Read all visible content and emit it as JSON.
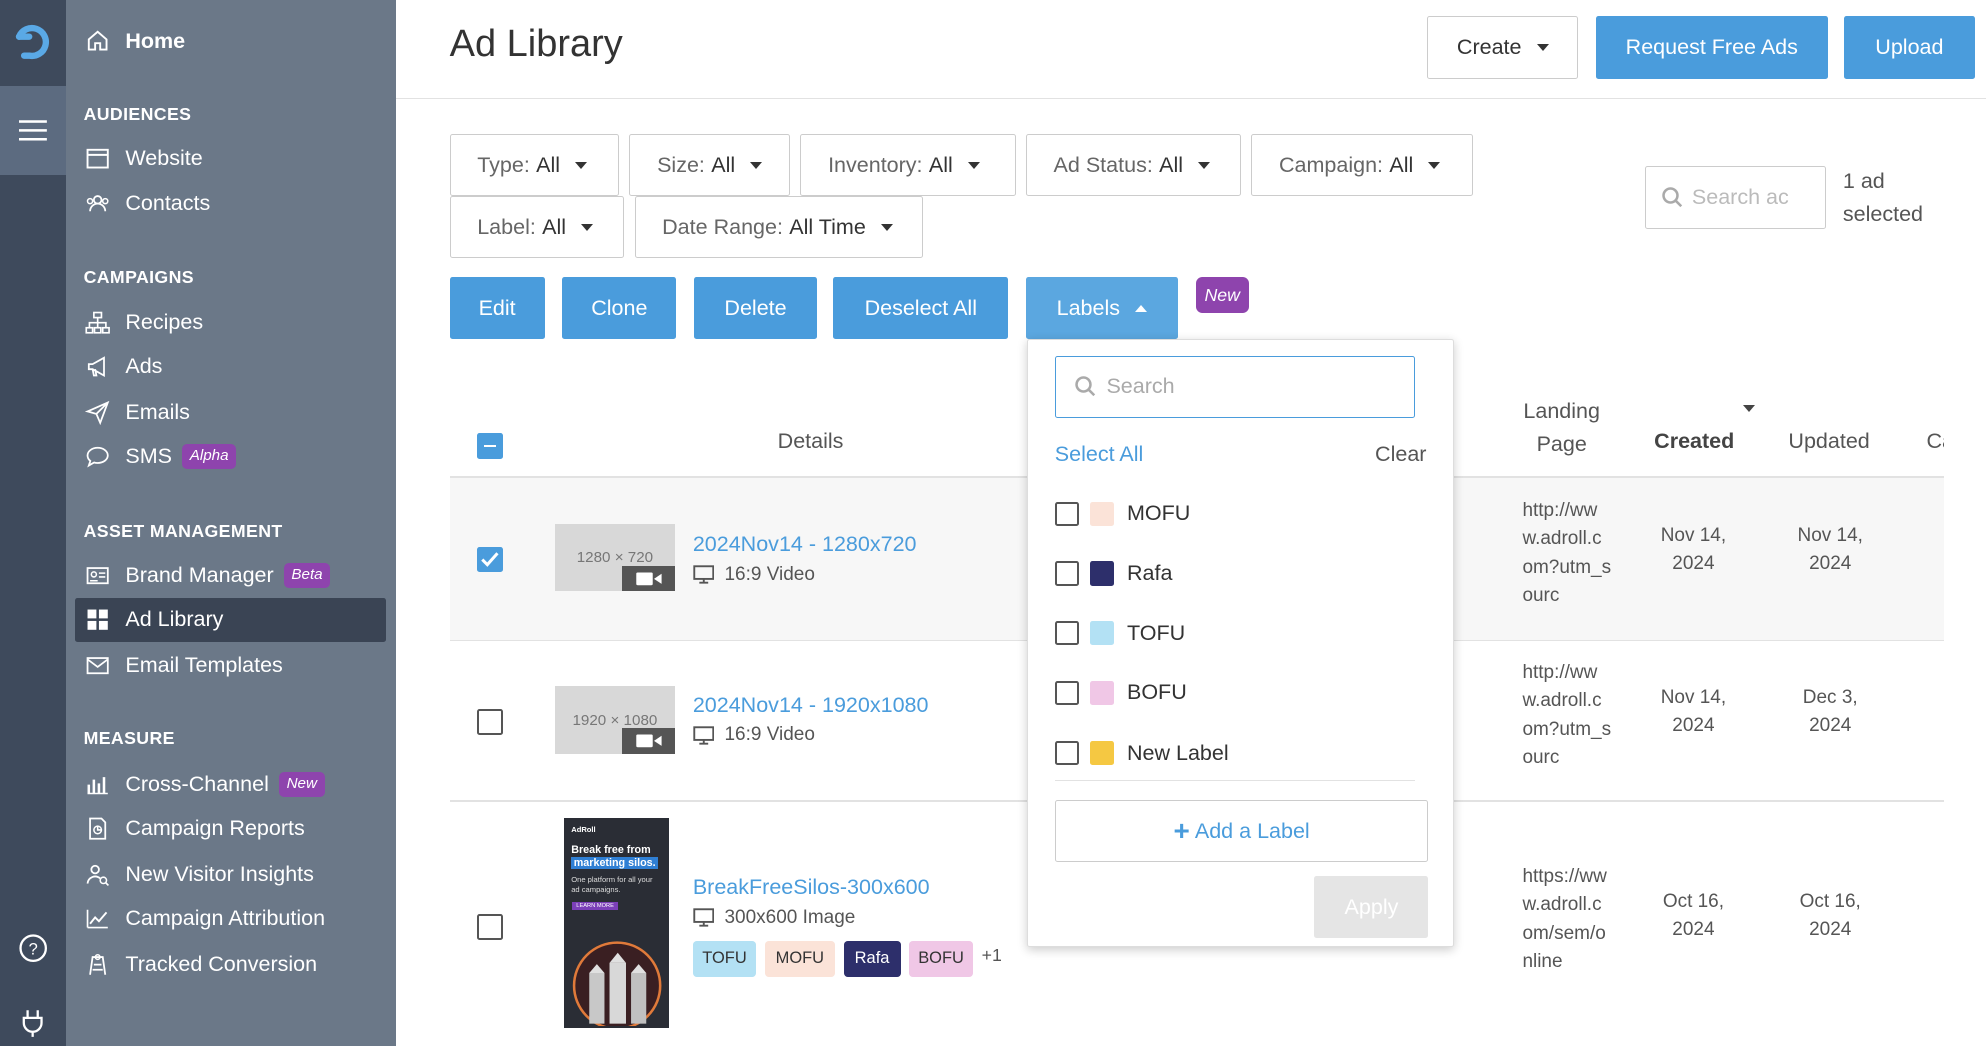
{
  "sidebar": {
    "home": "Home",
    "sections": {
      "audiences": "AUDIENCES",
      "campaigns": "CAMPAIGNS",
      "asset_management": "ASSET MANAGEMENT",
      "measure": "MEASURE"
    },
    "items": {
      "website": "Website",
      "contacts": "Contacts",
      "recipes": "Recipes",
      "ads": "Ads",
      "emails": "Emails",
      "sms": "SMS",
      "sms_badge": "Alpha",
      "brand_manager": "Brand Manager",
      "brand_manager_badge": "Beta",
      "ad_library": "Ad Library",
      "email_templates": "Email Templates",
      "cross_channel": "Cross-Channel",
      "cross_channel_badge": "New",
      "campaign_reports": "Campaign Reports",
      "new_visitor_insights": "New Visitor Insights",
      "campaign_attribution": "Campaign Attribution",
      "tracked_conversion": "Tracked Conversion"
    }
  },
  "header": {
    "title": "Ad Library",
    "create": "Create",
    "request_free_ads": "Request Free Ads",
    "upload": "Upload"
  },
  "filters": {
    "type": {
      "label": "Type:",
      "value": "All"
    },
    "size": {
      "label": "Size:",
      "value": "All"
    },
    "inventory": {
      "label": "Inventory:",
      "value": "All"
    },
    "ad_status": {
      "label": "Ad Status:",
      "value": "All"
    },
    "campaign": {
      "label": "Campaign:",
      "value": "All"
    },
    "label": {
      "label": "Label:",
      "value": "All"
    },
    "date_range": {
      "label": "Date Range:",
      "value": "All Time"
    }
  },
  "search": {
    "placeholder": "Search ac"
  },
  "selection": {
    "count_text": "1 ad selected"
  },
  "actions": {
    "edit": "Edit",
    "clone": "Clone",
    "delete": "Delete",
    "deselect_all": "Deselect All",
    "labels": "Labels",
    "new_badge": "New"
  },
  "table": {
    "headers": {
      "details": "Details",
      "landing_line1": "Landing",
      "landing_line2": "Page",
      "created": "Created",
      "updated": "Updated",
      "more": "Ca"
    },
    "rows": [
      {
        "thumb": "1280 × 720",
        "name": "2024Nov14 - 1280x720",
        "type": "16:9 Video",
        "landing": "http://www.adroll.com?utm_sourc",
        "created": "Nov 14, 2024",
        "updated": "Nov 14, 2024",
        "checked": true
      },
      {
        "thumb": "1920 × 1080",
        "name": "2024Nov14 - 1920x1080",
        "type": "16:9 Video",
        "landing": "http://www.adroll.com?utm_sourc",
        "created": "Nov 14, 2024",
        "updated": "Dec 3, 2024",
        "checked": false
      },
      {
        "name": "BreakFreeSilos-300x600",
        "type": "300x600 Image",
        "landing": "https://www.adroll.com/sem/online",
        "created": "Oct 16, 2024",
        "updated": "Oct 16, 2024",
        "checked": false,
        "tags": [
          "TOFU",
          "MOFU",
          "Rafa",
          "BOFU"
        ],
        "more_tags": "+1",
        "banner": {
          "brand": "AdRoll",
          "line1": "Break free from",
          "line2": "marketing silos.",
          "line3": "One platform for all your ad campaigns.",
          "cta": "LEARN MORE"
        }
      }
    ]
  },
  "labels_dropdown": {
    "search_placeholder": "Search",
    "select_all": "Select All",
    "clear": "Clear",
    "options": [
      {
        "name": "MOFU",
        "color": "#fbe3d8"
      },
      {
        "name": "Rafa",
        "color": "#2d2f6b"
      },
      {
        "name": "TOFU",
        "color": "#b3e1f4"
      },
      {
        "name": "BOFU",
        "color": "#f0c7e6"
      },
      {
        "name": "New Label",
        "color": "#f5c842"
      }
    ],
    "add_label": "Add a Label",
    "apply": "Apply"
  },
  "colors": {
    "accent": "#4a9cdc",
    "sidebar": "#6b7888",
    "rail": "#3e4a5c",
    "badge_purple": "#8e44ad"
  }
}
